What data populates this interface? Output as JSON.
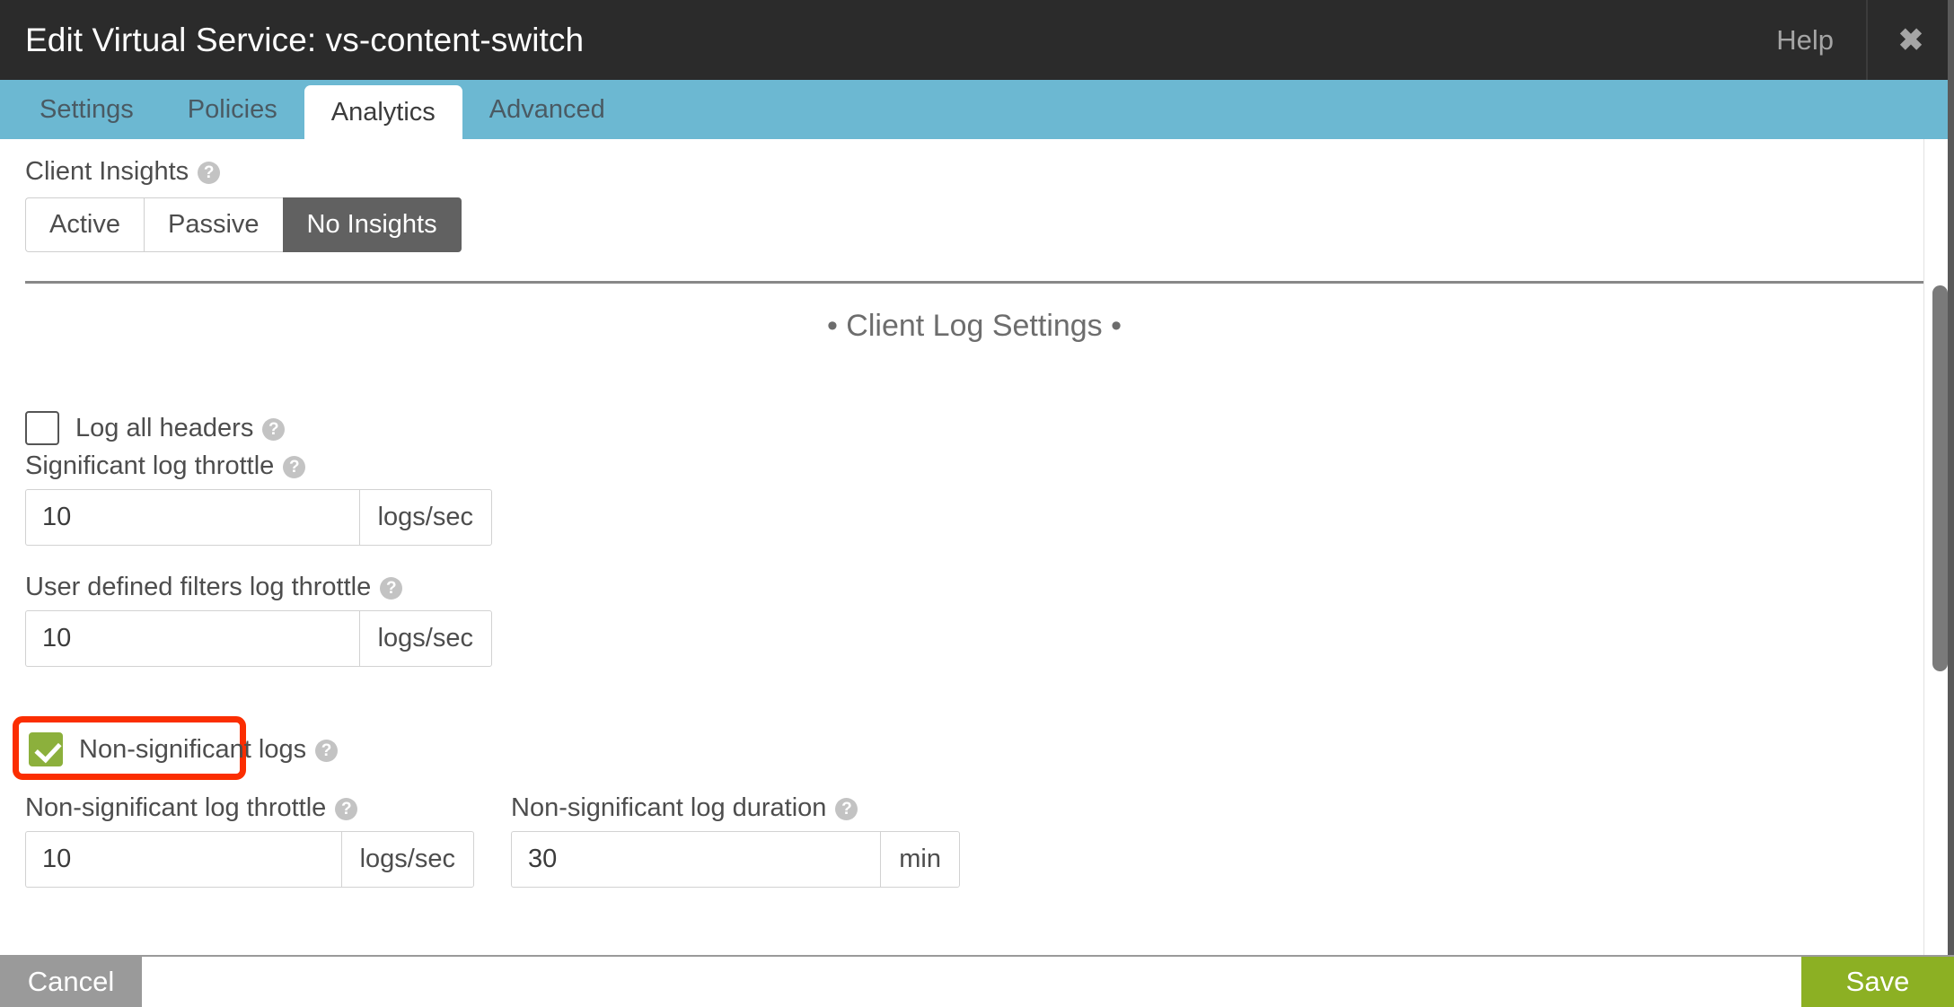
{
  "window": {
    "title": "Edit Virtual Service: vs-content-switch",
    "help_label": "Help",
    "close_icon": "close-icon",
    "close_glyph": "✖"
  },
  "tabs": [
    {
      "label": "Settings",
      "active": false
    },
    {
      "label": "Policies",
      "active": false
    },
    {
      "label": "Analytics",
      "active": true
    },
    {
      "label": "Advanced",
      "active": false
    }
  ],
  "client_insights": {
    "label": "Client Insights",
    "help_icon": "help-icon",
    "help_glyph": "?",
    "options": [
      {
        "label": "Active",
        "selected": false
      },
      {
        "label": "Passive",
        "selected": false
      },
      {
        "label": "No Insights",
        "selected": true
      }
    ]
  },
  "client_log_settings": {
    "group_title": "• Client Log Settings •",
    "log_all_headers": {
      "label": "Log all headers",
      "checked": false
    },
    "significant_log_throttle": {
      "label": "Significant log throttle",
      "value": "10",
      "unit": "logs/sec"
    },
    "user_defined_filters_log_throttle": {
      "label": "User defined filters log throttle",
      "value": "10",
      "unit": "logs/sec"
    },
    "non_significant_logs": {
      "label": "Non-significant logs",
      "checked": true,
      "highlighted": true
    },
    "non_significant_log_throttle": {
      "label": "Non-significant log throttle",
      "value": "10",
      "unit": "logs/sec"
    },
    "non_significant_log_duration": {
      "label": "Non-significant log duration",
      "value": "30",
      "unit": "min"
    }
  },
  "footer": {
    "cancel_label": "Cancel",
    "save_label": "Save"
  },
  "colors": {
    "titlebar": "#2b2b2b",
    "tabbar": "#6cb8d2",
    "save_green": "#8cb023",
    "checkbox_green": "#8cb03c",
    "highlight_red": "#fb2e01",
    "selected_segment": "#616161",
    "cancel_gray": "#9a9a9a"
  }
}
